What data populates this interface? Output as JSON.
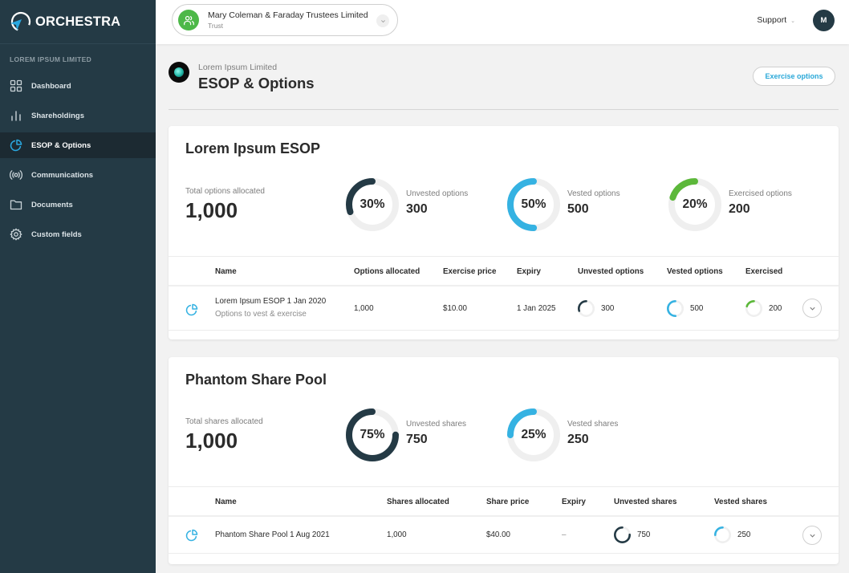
{
  "app": {
    "name": "ORCHESTRA"
  },
  "sidebar": {
    "org_label": "LOREM IPSUM LIMITED",
    "items": [
      {
        "label": "Dashboard",
        "icon": "grid-icon",
        "active": false
      },
      {
        "label": "Shareholdings",
        "icon": "bar-chart-icon",
        "active": false
      },
      {
        "label": "ESOP & Options",
        "icon": "pie-chart-icon",
        "active": true
      },
      {
        "label": "Communications",
        "icon": "broadcast-icon",
        "active": false
      },
      {
        "label": "Documents",
        "icon": "folder-icon",
        "active": false
      },
      {
        "label": "Custom fields",
        "icon": "gear-icon",
        "active": false
      }
    ]
  },
  "topbar": {
    "entity_name": "Mary Coleman & Faraday Trustees Limited",
    "entity_type": "Trust",
    "support_label": "Support",
    "user_initial": "M"
  },
  "page": {
    "company_name": "Lorem Ipsum Limited",
    "title": "ESOP & Options",
    "exercise_button": "Exercise options"
  },
  "colors": {
    "dark": "#243a45",
    "blue": "#35b2e2",
    "green": "#5cb83a",
    "track": "#efefef"
  },
  "esop": {
    "title": "Lorem Ipsum ESOP",
    "total_label": "Total options allocated",
    "total_value": "1,000",
    "stats": [
      {
        "label": "Unvested options",
        "value": "300",
        "pct_text": "30%",
        "fraction": 0.3,
        "color": "dark"
      },
      {
        "label": "Vested options",
        "value": "500",
        "pct_text": "50%",
        "fraction": 0.5,
        "color": "blue"
      },
      {
        "label": "Exercised options",
        "value": "200",
        "pct_text": "20%",
        "fraction": 0.2,
        "color": "green"
      }
    ],
    "table": {
      "headers": [
        "Name",
        "Options allocated",
        "Exercise price",
        "Expiry",
        "Unvested options",
        "Vested options",
        "Exercised"
      ],
      "rows": [
        {
          "name": "Lorem Ipsum ESOP 1 Jan 2020",
          "subtitle": "Options to vest & exercise",
          "allocated": "1,000",
          "price": "$10.00",
          "expiry": "1 Jan 2025",
          "unvested": {
            "value": "300",
            "fraction": 0.3
          },
          "vested": {
            "value": "500",
            "fraction": 0.5
          },
          "exercised": {
            "value": "200",
            "fraction": 0.2
          }
        }
      ]
    }
  },
  "phantom": {
    "title": "Phantom Share Pool",
    "total_label": "Total shares allocated",
    "total_value": "1,000",
    "stats": [
      {
        "label": "Unvested shares",
        "value": "750",
        "pct_text": "75%",
        "fraction": 0.75,
        "color": "dark"
      },
      {
        "label": "Vested shares",
        "value": "250",
        "pct_text": "25%",
        "fraction": 0.25,
        "color": "blue"
      }
    ],
    "table": {
      "headers": [
        "Name",
        "Shares allocated",
        "Share price",
        "Expiry",
        "Unvested shares",
        "Vested shares"
      ],
      "rows": [
        {
          "name": "Phantom Share Pool 1 Aug 2021",
          "allocated": "1,000",
          "price": "$40.00",
          "expiry": "–",
          "unvested": {
            "value": "750",
            "fraction": 0.75
          },
          "vested": {
            "value": "250",
            "fraction": 0.25
          }
        }
      ]
    }
  }
}
